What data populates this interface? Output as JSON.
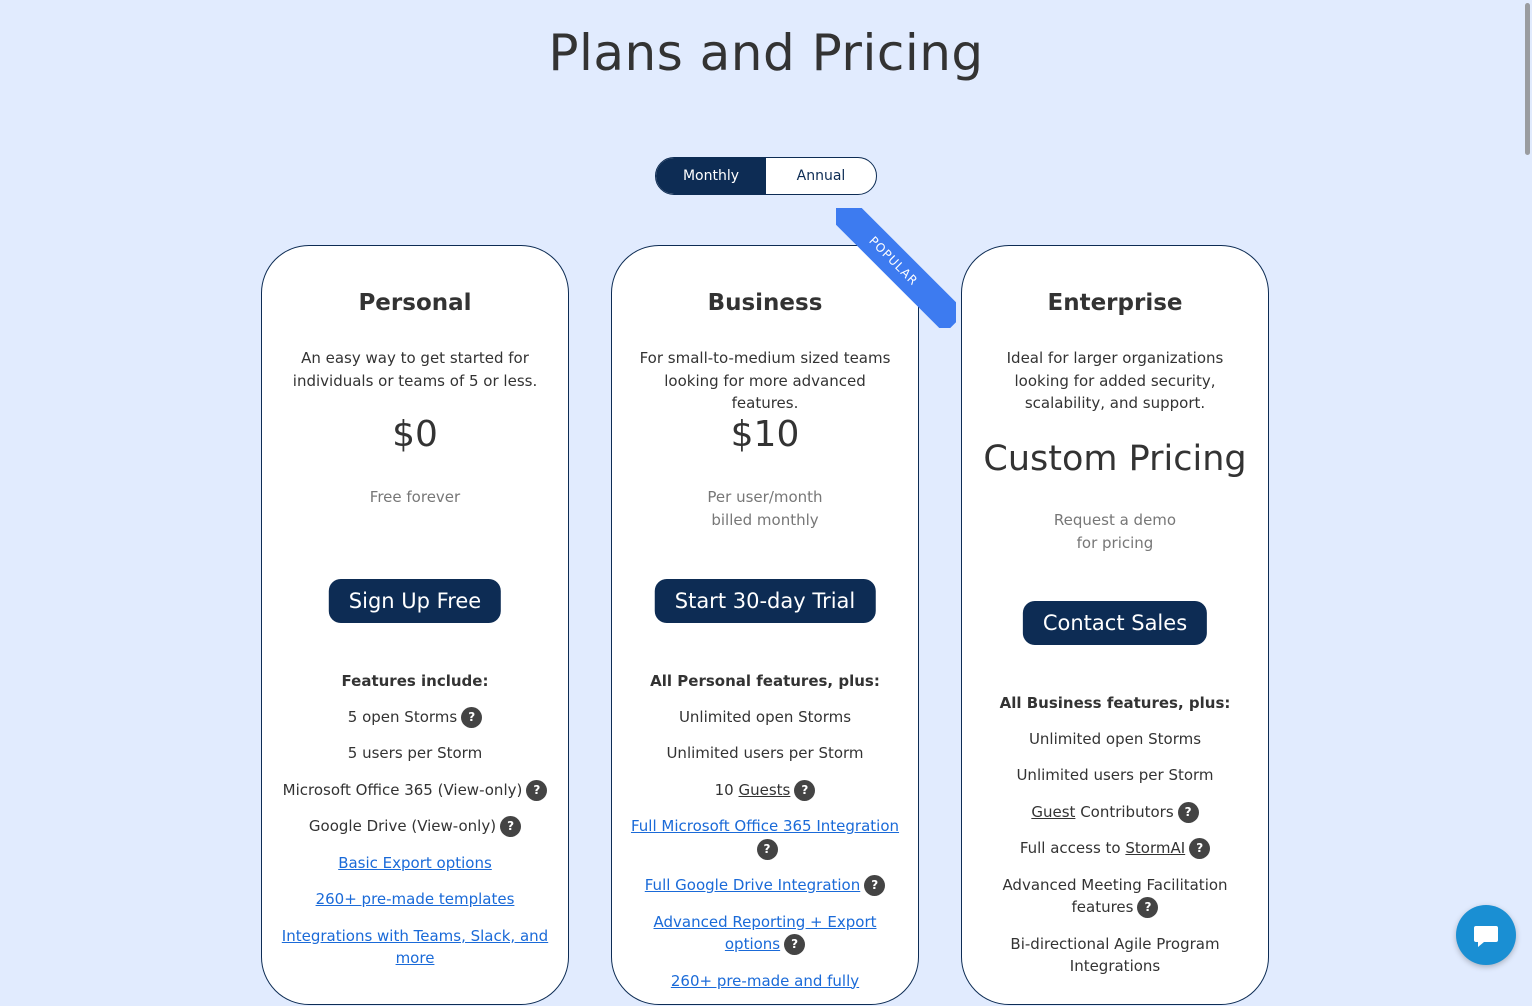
{
  "page": {
    "title": "Plans and Pricing"
  },
  "billing_toggle": {
    "monthly": "Monthly",
    "annual": "Annual",
    "selected": "Monthly"
  },
  "ribbon": {
    "label": "POPULAR"
  },
  "plans": {
    "personal": {
      "name": "Personal",
      "description": "An easy way to get started for individuals or teams of 5 or less.",
      "price": "$0",
      "note": [
        "Free forever"
      ],
      "cta": "Sign Up Free",
      "features_heading": "Features include:",
      "features": [
        "5 open Storms",
        "5 users per Storm",
        "Microsoft Office 365 (View-only)",
        "Google Drive (View-only)",
        "Basic Export options",
        "260+ pre-made templates",
        "Integrations with Teams, Slack, and more"
      ]
    },
    "business": {
      "name": "Business",
      "description": "For small-to-medium sized teams looking for more advanced features.",
      "price": "$10",
      "note": [
        "Per user/month",
        "billed monthly"
      ],
      "cta": "Start 30-day Trial",
      "features_heading": "All Personal features, plus:",
      "features": [
        "Unlimited open Storms",
        "Unlimited users per Storm",
        "10",
        "Guests",
        "Full Microsoft Office 365 Integration",
        "Full Google Drive Integration",
        "Advanced Reporting + Export options",
        "260+ pre-made and fully"
      ]
    },
    "enterprise": {
      "name": "Enterprise",
      "description": "Ideal for larger organizations looking for added security, scalability, and support.",
      "price": "Custom Pricing",
      "note": [
        "Request a demo",
        "for pricing"
      ],
      "cta": "Contact Sales",
      "features_heading": "All Business features, plus:",
      "features": [
        "Unlimited open Storms",
        "Unlimited users per Storm",
        "Guest",
        "Contributors",
        "Full access to",
        "StormAI",
        "Advanced Meeting Facilitation features",
        "Bi-directional Agile Program Integrations"
      ]
    }
  },
  "help_glyph": "?",
  "colors": {
    "background": "#e1ebfe",
    "navy": "#0d2c54",
    "link": "#1a6ad8",
    "ribbon": "#3d7bf0",
    "chat": "#1a8fd3"
  }
}
